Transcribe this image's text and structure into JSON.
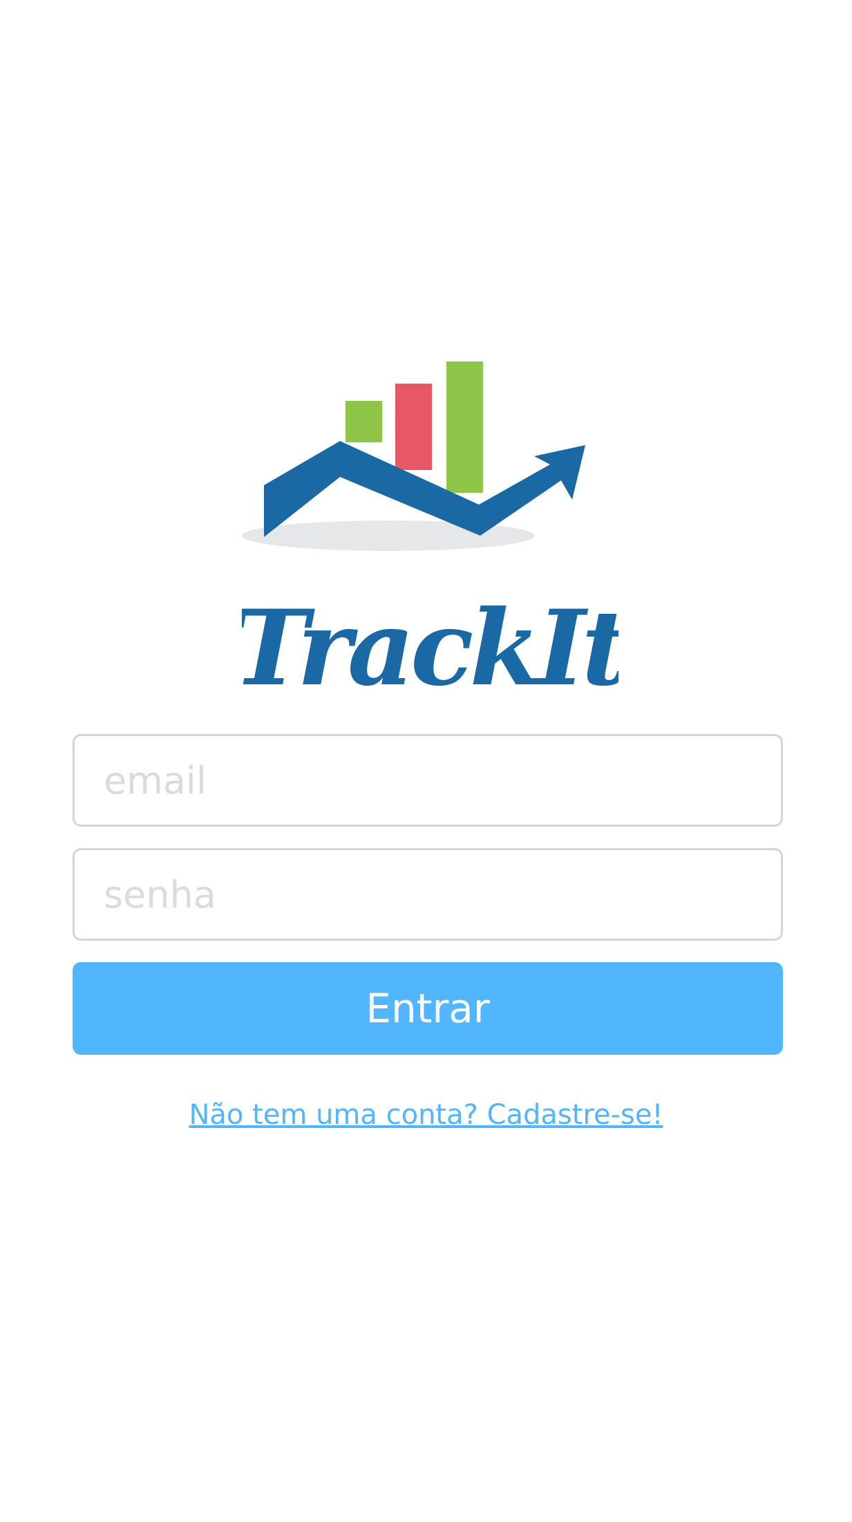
{
  "brand": {
    "name": "TrackIt",
    "colors": {
      "blue": "#1a69a5",
      "green": "#8fc549",
      "red": "#e75766",
      "shadow": "#e6e7e8"
    }
  },
  "form": {
    "email_placeholder": "email",
    "password_placeholder": "senha",
    "email_value": "",
    "password_value": "",
    "submit_label": "Entrar",
    "submit_color": "#52b6ff"
  },
  "signup": {
    "link_text": "Não tem uma conta? Cadastre-se!"
  }
}
